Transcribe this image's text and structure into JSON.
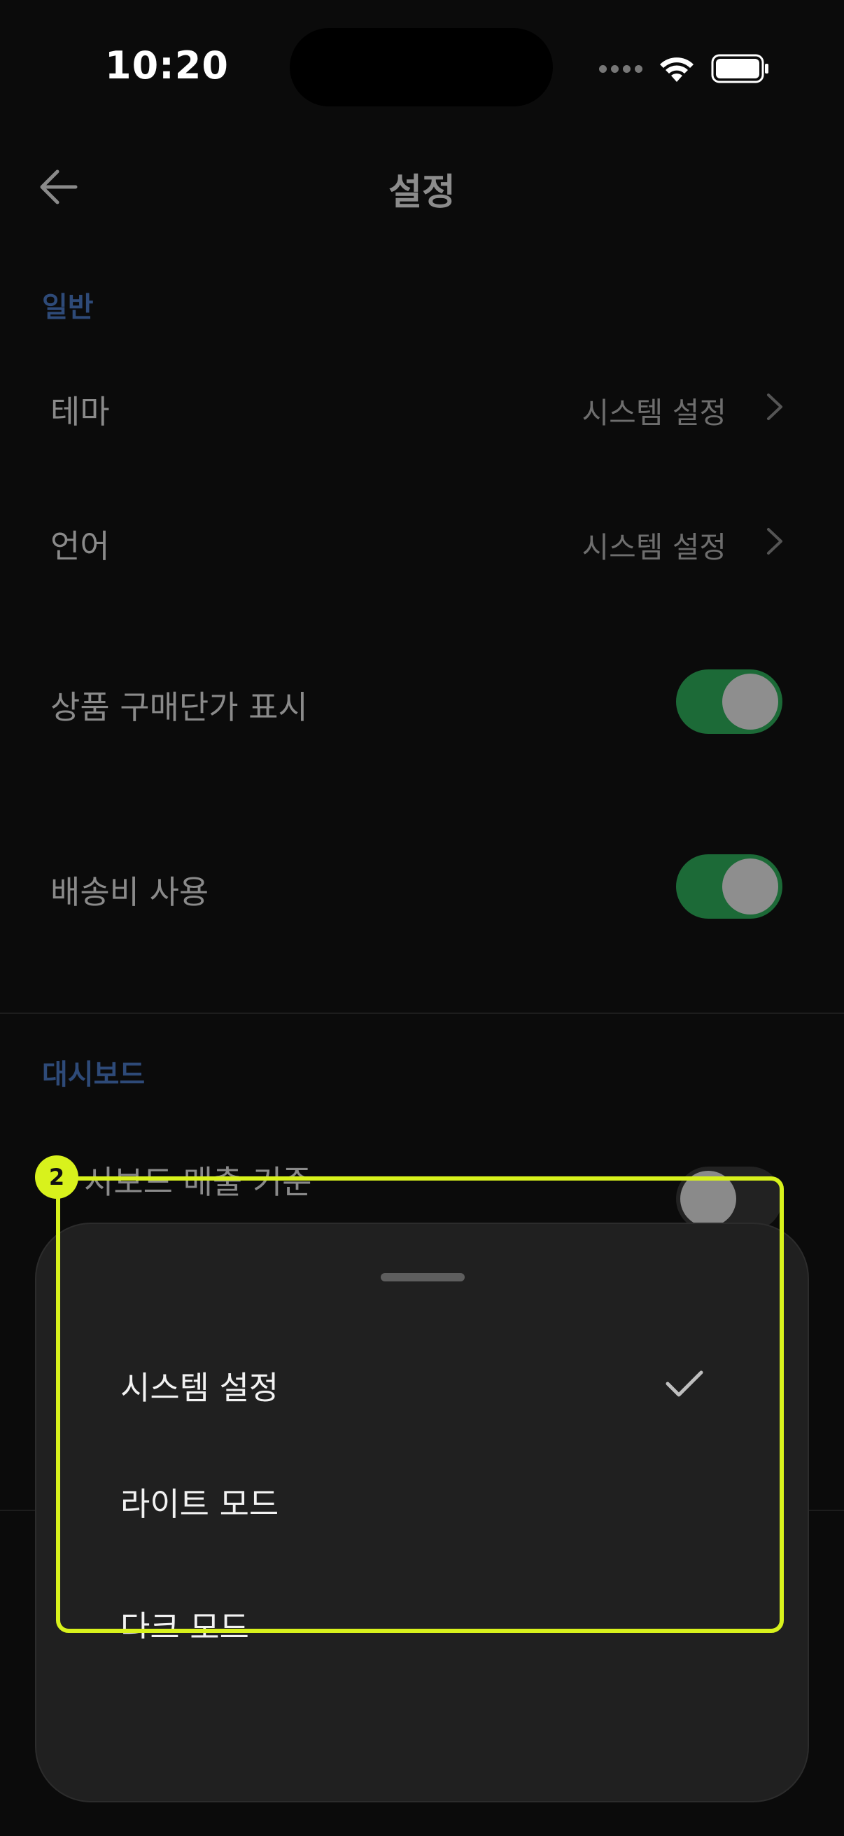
{
  "status_bar": {
    "time": "10:20"
  },
  "header": {
    "title": "설정"
  },
  "sections": {
    "general": {
      "label": "일반",
      "theme": {
        "label": "테마",
        "value": "시스템 설정"
      },
      "language": {
        "label": "언어",
        "value": "시스템 설정"
      },
      "show_purchase_price": {
        "label": "상품 구매단가 표시",
        "on": true
      },
      "use_shipping_fee": {
        "label": "배송비 사용",
        "on": true
      }
    },
    "dashboard": {
      "label": "대시보드",
      "sales_basis": {
        "label": "시보드 매출 기준",
        "on": false
      }
    }
  },
  "theme_sheet": {
    "options": [
      {
        "label": "시스템 설정",
        "selected": true
      },
      {
        "label": "라이트 모드",
        "selected": false
      },
      {
        "label": "다크 모드",
        "selected": false
      }
    ]
  },
  "annotation": {
    "badge": "2",
    "color": "#d8f21c"
  },
  "colors": {
    "toggle_on": "#1c6a37",
    "section_label": "#2e4a78",
    "sheet_bg": "#202020"
  }
}
